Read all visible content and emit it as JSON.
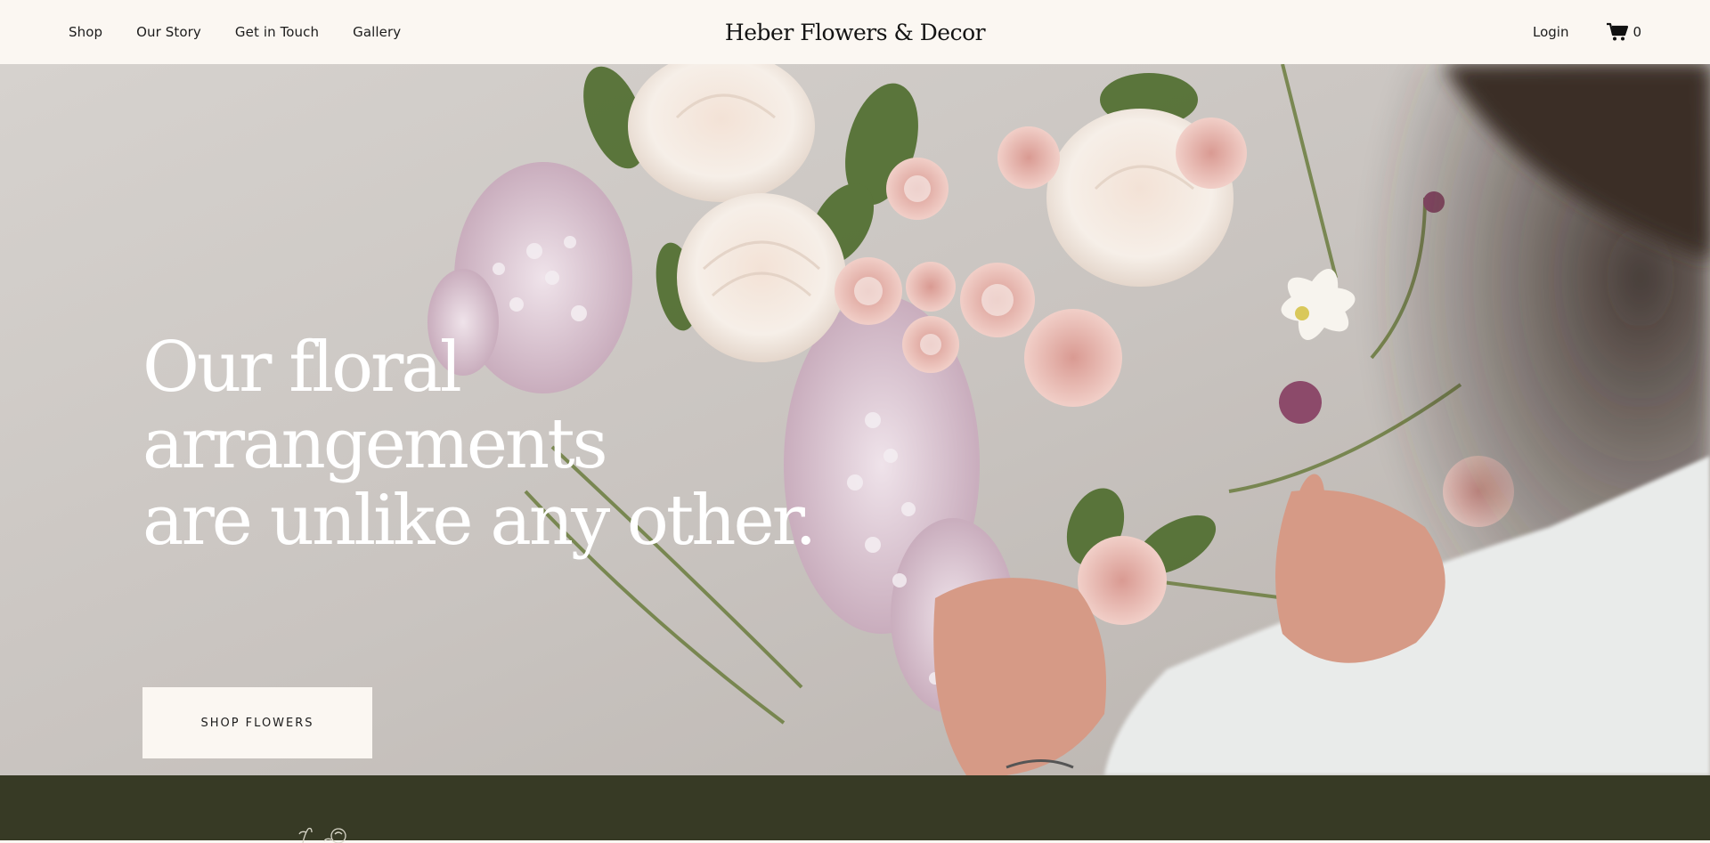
{
  "header": {
    "nav": [
      "Shop",
      "Our Story",
      "Get in Touch",
      "Gallery"
    ],
    "brand": "Heber Flowers & Decor",
    "login": "Login",
    "cart_count": "0"
  },
  "hero": {
    "heading_line1": "Our floral arrangements",
    "heading_line2": "are unlike any other.",
    "cta": "SHOP FLOWERS"
  },
  "colors": {
    "header_bg": "#fbf7f2",
    "footer_bg": "#373a25",
    "text": "#1c1c1c"
  },
  "icons": [
    "cart-icon",
    "floral-sprig-icon"
  ]
}
